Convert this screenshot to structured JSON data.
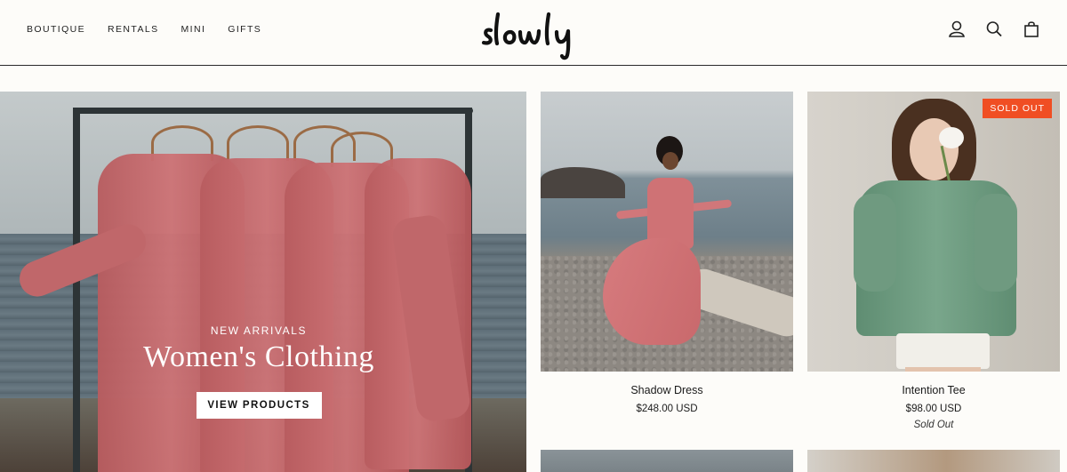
{
  "header": {
    "nav": [
      "BOUTIQUE",
      "RENTALS",
      "MINI",
      "GIFTS"
    ],
    "logo_text": "slowly",
    "icons": [
      "account-icon",
      "search-icon",
      "cart-icon"
    ]
  },
  "hero": {
    "kicker": "NEW ARRIVALS",
    "title": "Women's Clothing",
    "button_label": "VIEW PRODUCTS"
  },
  "products": [
    {
      "name": "Shadow Dress",
      "price": "$248.00 USD",
      "badge": "",
      "status": ""
    },
    {
      "name": "Intention Tee",
      "price": "$98.00 USD",
      "badge": "SOLD OUT",
      "status": "Sold Out"
    }
  ],
  "colors": {
    "accent_badge": "#f04e23",
    "dress_pink": "#c66a6d",
    "tee_green": "#6f9a80"
  }
}
